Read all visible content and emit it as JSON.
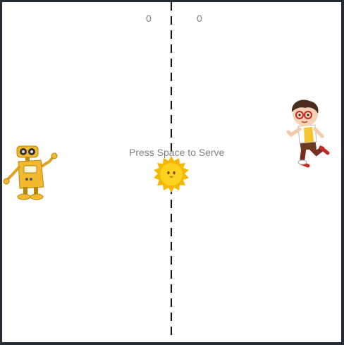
{
  "scores": {
    "left": "0",
    "right": "0"
  },
  "message": "Press Space to Serve",
  "sprites": {
    "left_paddle": "robot-icon",
    "right_paddle": "boy-icon",
    "ball": "sun-icon"
  },
  "colors": {
    "frame": "#242b33",
    "field": "#ffffff",
    "text": "#808080",
    "net": "#111111",
    "ball": "#fcc419",
    "robot": "#f2b830"
  }
}
